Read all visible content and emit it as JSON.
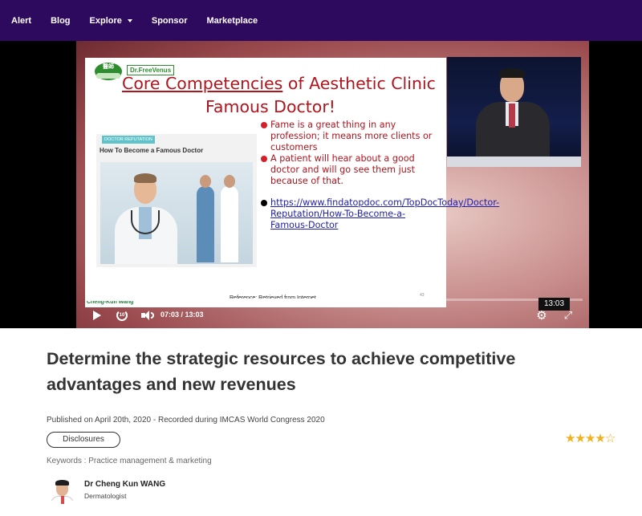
{
  "nav": {
    "items": [
      {
        "label": "Alert"
      },
      {
        "label": "Blog"
      },
      {
        "label": "Explore"
      },
      {
        "label": "Sponsor"
      },
      {
        "label": "Marketplace"
      }
    ]
  },
  "player": {
    "slide": {
      "logo_text": "Dr.FreeVenus",
      "logo_seal_text": "醫師",
      "title_line1_underlined": "Core Competencies",
      "title_line1_rest": " of Aesthetic Clinic",
      "title_line2": "Famous Doctor!",
      "card_tag": "DOCTOR REPUTATION",
      "card_title": "How To Become a Famous Doctor",
      "bullets": [
        "Fame is a great thing in any profession; it means more clients or customers",
        "A patient will hear about a good doctor and will go see them just because of that."
      ],
      "link": "https://www.findatopdoc.com/TopDocToday/Doctor-Reputation/How-To-Become-a-Famous-Doctor",
      "reference": "Reference: Retrieved from Internet",
      "page_number": "43",
      "speaker_caption": "Cheng-Kun Wang"
    },
    "hover_time": "13:03",
    "timecode": "07:03 / 13:03",
    "progress": 0.54
  },
  "video": {
    "title": "Determine the strategic resources to achieve competitive advantages and new revenues",
    "published": "Published on April 20th, 2020 - Recorded during IMCAS World Congress 2020",
    "disclosures_label": "Disclosures",
    "rating": 4,
    "rating_max": 5,
    "keywords": "Keywords : Practice management & marketing"
  },
  "author": {
    "name": "Dr Cheng Kun WANG",
    "role": "Dermatologist"
  },
  "colors": {
    "nav_bg": "#2e0a5f",
    "slide_red": "#b0141d",
    "star": "#f2b01e"
  }
}
